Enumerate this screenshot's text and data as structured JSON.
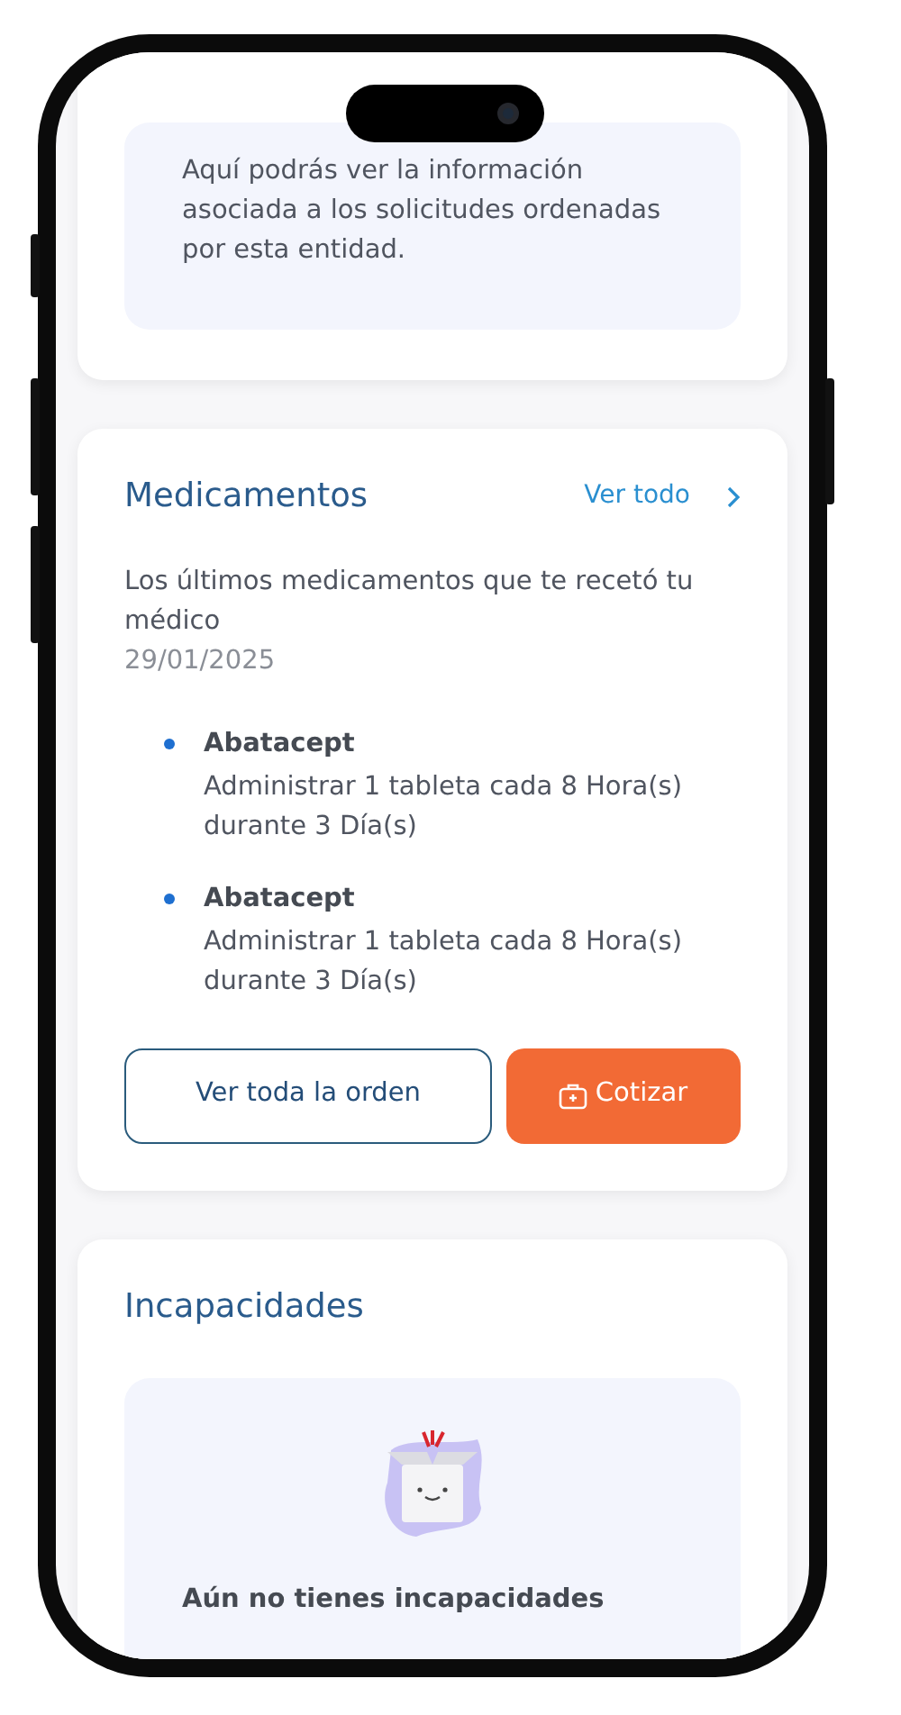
{
  "intro_card": {
    "text": "Aquí podrás ver la información asociada a los solicitudes ordenadas por esta entidad."
  },
  "medications": {
    "title": "Medicamentos",
    "link": "Ver todo",
    "subtitle": "Los últimos medicamentos que te recetó tu médico",
    "date": "29/01/2025",
    "items": [
      {
        "name": "Abatacept",
        "instructions": "Administrar 1 tableta cada 8 Hora(s) durante 3 Día(s)"
      },
      {
        "name": "Abatacept",
        "instructions": "Administrar 1 tableta cada 8 Hora(s) durante 3 Día(s)"
      }
    ],
    "buttons": [
      {
        "label": "Ver toda la orden",
        "kind": "outline"
      },
      {
        "label": "Cotizar",
        "kind": "primary"
      }
    ]
  },
  "disabilities": {
    "title": "Incapacidades",
    "empty_message": "Aún no tienes incapacidades"
  }
}
